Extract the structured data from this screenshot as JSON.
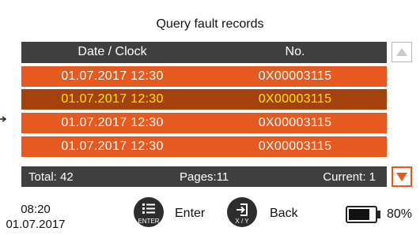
{
  "screen": {
    "title": "Query fault records"
  },
  "table": {
    "headers": {
      "date": "Date / Clock",
      "number": "No."
    },
    "rows": [
      {
        "date": "01.07.2017  12:30",
        "number": "0X00003115",
        "selected": false
      },
      {
        "date": "01.07.2017  12:30",
        "number": "0X00003115",
        "selected": true
      },
      {
        "date": "01.07.2017  12:30",
        "number": "0X00003115",
        "selected": false
      },
      {
        "date": "01.07.2017  12:30",
        "number": "0X00003115",
        "selected": false
      }
    ]
  },
  "footer": {
    "total": "Total: 42",
    "pages": "Pages:11",
    "current": "Current: 1"
  },
  "status": {
    "time": "08:20",
    "date": "01.07.2017",
    "enter_label": "Enter",
    "enter_key": "ENTER",
    "back_label": "Back",
    "back_key": "X / Y",
    "battery_text": "80%",
    "battery_level": 0.8
  },
  "colors": {
    "row": "#e65a1f",
    "row_selected": "#a4410d",
    "selected_text": "#ffe600",
    "header": "#3f3f3f"
  },
  "icons": {
    "scroll_up": "triangle-up-icon",
    "scroll_down": "triangle-down-icon",
    "enter": "list-icon",
    "back": "exit-icon",
    "pointer": "arrow-right-icon"
  }
}
